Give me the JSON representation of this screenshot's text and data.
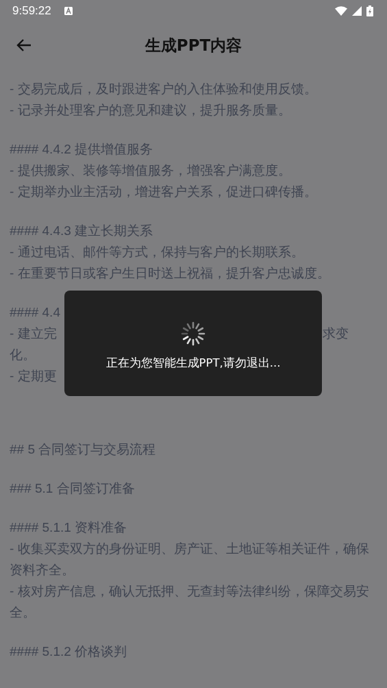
{
  "status_bar": {
    "time": "9:59:22"
  },
  "header": {
    "title": "生成PPT内容"
  },
  "content": [
    {
      "lines": [
        {
          "text": "- 交易完成后，及时跟进客户的入住体验和使用反馈。"
        },
        {
          "text": "- 记录并处理客户的意见和建议，提升服务质量。"
        }
      ]
    },
    {
      "lines": [
        {
          "text": "#### 4.4.2 提供增值服务"
        },
        {
          "text": "- 提供搬家、装修等增值服务，增强客户满意度。"
        },
        {
          "text": "- 定期举办业主活动，增进客户关系，促进口碑传播。"
        }
      ]
    },
    {
      "lines": [
        {
          "text": "#### 4.4.3 建立长期关系"
        },
        {
          "text": "- 通过电话、邮件等方式，保持与客户的长期联系。"
        },
        {
          "text": "- 在重要节日或客户生日时送上祝福，提升客户忠诚度。"
        }
      ]
    },
    {
      "lines": [
        {
          "text": "#### 4.4"
        },
        {
          "text": "- 建立完",
          "tail": "求变"
        },
        {
          "text": "化。"
        },
        {
          "text": "- 定期更"
        }
      ]
    },
    {
      "lines": [
        {
          "text": "## 5 合同签订与交易流程"
        }
      ]
    },
    {
      "lines": [
        {
          "text": "### 5.1 合同签订准备"
        }
      ]
    },
    {
      "lines": [
        {
          "text": "#### 5.1.1 资料准备"
        },
        {
          "text": "- 收集买卖双方的身份证明、房产证、土地证等相关证件，确保资料齐全。"
        },
        {
          "text": "- 核对房产信息，确认无抵押、无查封等法律纠纷，保障交易安全。"
        }
      ]
    },
    {
      "lines": [
        {
          "text": "#### 5.1.2 价格谈判"
        }
      ]
    }
  ],
  "dialog": {
    "message": "正在为您智能生成PPT,请勿退出..."
  }
}
